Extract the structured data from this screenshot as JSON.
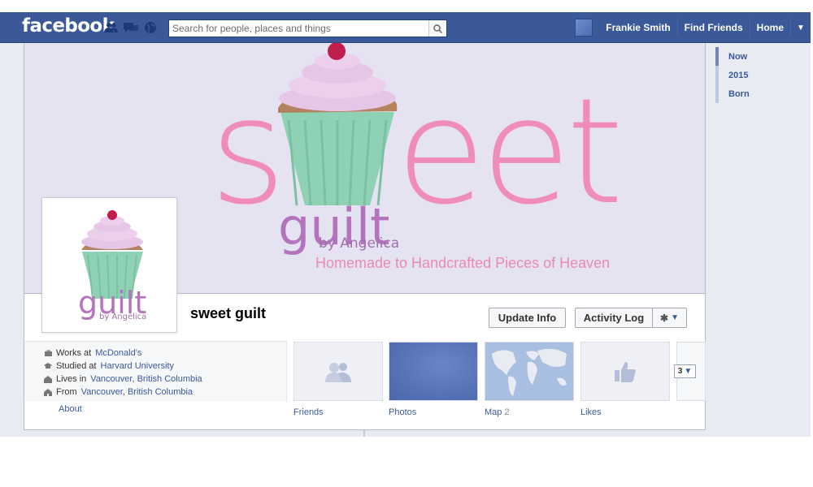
{
  "topbar": {
    "logo": "facebook",
    "search_placeholder": "Search for people, places and things",
    "user_name": "Frankie Smith",
    "find_friends": "Find Friends",
    "home": "Home"
  },
  "cover": {
    "logo_word": "sweet",
    "logo_sub": "guilt",
    "logo_by": "by Angelica",
    "tagline": "Homemade to Handcrafted Pieces of Heaven"
  },
  "profile": {
    "name": "sweet guilt",
    "logo_sub": "guilt",
    "logo_by": "by Angelica",
    "update_info": "Update Info",
    "activity_log": "Activity Log"
  },
  "about": {
    "rows": [
      {
        "prefix": "Works at",
        "link": "McDonald's",
        "icon": "briefcase-icon"
      },
      {
        "prefix": "Studied at",
        "link": "Harvard University",
        "icon": "graduation-cap-icon"
      },
      {
        "prefix": "Lives in",
        "link": "Vancouver, British Columbia",
        "icon": "house-icon"
      },
      {
        "prefix": "From",
        "link": "Vancouver, British Columbia",
        "icon": "home-origin-icon"
      }
    ],
    "label": "About"
  },
  "tiles": {
    "friends": "Friends",
    "photos": "Photos",
    "map": "Map",
    "map_count": "2",
    "likes": "Likes",
    "more_count": "3"
  },
  "scrubber": [
    "Now",
    "2015",
    "Born"
  ],
  "colors": {
    "brand_blue": "#3b5998",
    "cover_bg": "#e5e2f1",
    "sweet_pink": "#f08cbc",
    "guilt_purple": "#b374bd",
    "mint": "#8fd1b5"
  }
}
